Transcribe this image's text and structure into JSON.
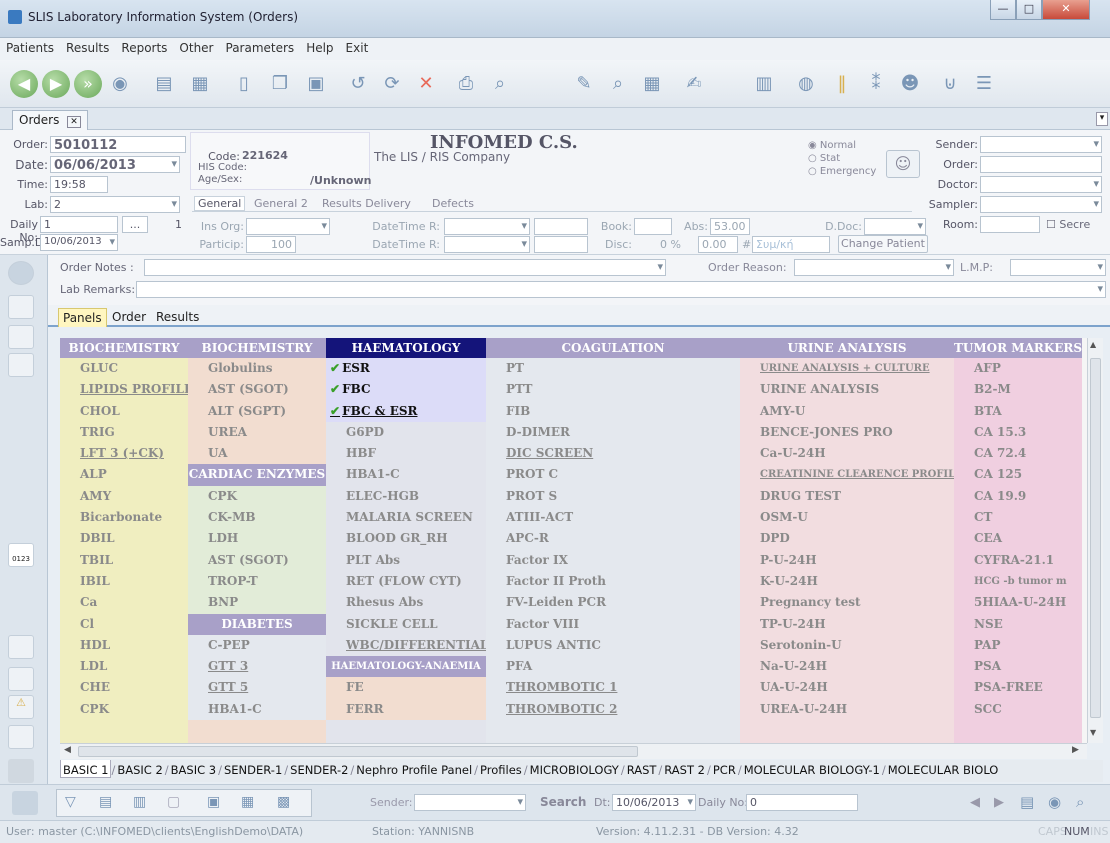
{
  "window": {
    "title": "SLIS Laboratory Information System (Orders)",
    "min": "—",
    "max": "□",
    "close": "✕"
  },
  "menu": [
    "Patients",
    "Results",
    "Reports",
    "Other",
    "Parameters",
    "Help",
    "Exit"
  ],
  "doc_tab": {
    "label": "Orders",
    "close": "✕"
  },
  "header": {
    "order_label": "Order:",
    "order_value": "5010112",
    "date_label": "Date:",
    "date_value": "06/06/2013",
    "time_label": "Time:",
    "time_value": "19:58",
    "lab_label": "Lab:",
    "lab_value": "2",
    "daily_label": "Daily No:",
    "daily_value": "1",
    "daily_count": "1",
    "daily_btn": "...",
    "samp_label": "Samp.D:",
    "samp_value": "10/06/2013",
    "code_label": "Code:",
    "code_value": "221624",
    "his_label": "HIS Code:",
    "agesex_label": "Age/Sex:",
    "agesex_value": "/Unknown",
    "company": "INFOMED C.S.",
    "company_sub": "The LIS / RIS Company",
    "priority": [
      "Normal",
      "Stat",
      "Emergency"
    ],
    "sender_label": "Sender:",
    "order2_label": "Order:",
    "doctor_label": "Doctor:",
    "sampler_label": "Sampler:",
    "room_label": "Room:",
    "secret_label": "Secre",
    "info_tabs": [
      "General",
      "General 2",
      "Results Delivery",
      "Defects"
    ],
    "ins_org_label": "Ins Org:",
    "particip_label": "Particip:",
    "particip_value": "100",
    "dtr1_label": "DateTime R:",
    "dtr2_label": "DateTime R:",
    "book_label": "Book:",
    "abs_label": "Abs:",
    "abs_value": "53.00",
    "disc_label": "Disc:",
    "disc_pct": "0 %",
    "disc_value": "0.00",
    "sym": "#",
    "sym_placeholder": "Συμ/κή",
    "ddoc_label": "D.Doc:",
    "change_patient": "Change Patient"
  },
  "notes": {
    "order_notes_label": "Order Notes :",
    "order_reason_label": "Order Reason:",
    "lmp_label": "L.M.P:",
    "lab_remarks_label": "Lab Remarks:"
  },
  "subtabs": [
    "Panels",
    "Order",
    "Results"
  ],
  "grid": [
    {
      "header": "BIOCHEMISTRY",
      "hcolor": "#a8a0c8",
      "bg": "#f0eec0",
      "items": [
        {
          "t": "GLUC"
        },
        {
          "t": "LIPIDS PROFILE",
          "ul": true
        },
        {
          "t": "CHOL"
        },
        {
          "t": "TRIG"
        },
        {
          "t": "LFT 3 (+CK)",
          "ul": true
        },
        {
          "t": "ALP"
        },
        {
          "t": "AMY"
        },
        {
          "t": "Bicarbonate"
        },
        {
          "t": "DBIL"
        },
        {
          "t": "TBIL"
        },
        {
          "t": "IBIL"
        },
        {
          "t": "Ca"
        },
        {
          "t": "Cl"
        },
        {
          "t": "HDL"
        },
        {
          "t": "LDL"
        },
        {
          "t": "CHE"
        },
        {
          "t": "CPK"
        }
      ]
    },
    {
      "header": "BIOCHEMISTRY",
      "hcolor": "#a8a0c8",
      "bg": "#f2ddd0",
      "items": [
        {
          "t": "Globulins"
        },
        {
          "t": "AST (SGOT)"
        },
        {
          "t": "ALT (SGPT)"
        },
        {
          "t": "UREA"
        },
        {
          "t": "UA"
        },
        {
          "t": "CARDIAC ENZYMES",
          "sub": "#a8a0c8"
        },
        {
          "t": "CPK",
          "bg": "#e2ecd8"
        },
        {
          "t": "CK-MB",
          "bg": "#e2ecd8"
        },
        {
          "t": "LDH",
          "bg": "#e2ecd8"
        },
        {
          "t": "AST (SGOT)",
          "bg": "#e2ecd8"
        },
        {
          "t": "TROP-T",
          "bg": "#e2ecd8"
        },
        {
          "t": "BNP",
          "bg": "#e2ecd8"
        },
        {
          "t": "DIABETES",
          "sub": "#a8a0c8"
        },
        {
          "t": "C-PEP",
          "bg": "#e4e8ee"
        },
        {
          "t": "GTT 3",
          "ul": true,
          "bg": "#e4e8ee"
        },
        {
          "t": "GTT 5",
          "ul": true,
          "bg": "#e4e8ee"
        },
        {
          "t": "HBA1-C",
          "bg": "#e4e8ee"
        }
      ]
    },
    {
      "header": "HAEMATOLOGY",
      "hcolor": "#14147a",
      "bg": "#e2e4ec",
      "items": [
        {
          "t": "ESR",
          "hl": true
        },
        {
          "t": "FBC",
          "hl": true
        },
        {
          "t": "FBC & ESR",
          "hl": true,
          "ul": true
        },
        {
          "t": "G6PD"
        },
        {
          "t": "HBF"
        },
        {
          "t": "HBA1-C"
        },
        {
          "t": "ELEC-HGB"
        },
        {
          "t": "MALARIA SCREEN"
        },
        {
          "t": "BLOOD GR_RH"
        },
        {
          "t": "PLT Abs"
        },
        {
          "t": "RET (FLOW CYT)"
        },
        {
          "t": "Rhesus Abs"
        },
        {
          "t": "SICKLE CELL"
        },
        {
          "t": "WBC/DIFFERENTIAL",
          "ul": true
        },
        {
          "t": "HAEMATOLOGY-ANAEMIA",
          "sub": "#a8a0c8",
          "sm": true
        },
        {
          "t": "FE",
          "bg": "#f2ddd0"
        },
        {
          "t": "FERR",
          "bg": "#f2ddd0"
        }
      ]
    },
    {
      "header": "COAGULATION",
      "hcolor": "#a8a0c8",
      "bg": "#e4e8ee",
      "items": [
        {
          "t": "PT"
        },
        {
          "t": "PTT"
        },
        {
          "t": "FIB"
        },
        {
          "t": "D-DIMER"
        },
        {
          "t": "DIC SCREEN",
          "ul": true
        },
        {
          "t": "PROT C"
        },
        {
          "t": "PROT S"
        },
        {
          "t": "ATIII-ACT"
        },
        {
          "t": "APC-R"
        },
        {
          "t": "Factor IX"
        },
        {
          "t": "Factor II Proth"
        },
        {
          "t": "FV-Leiden PCR"
        },
        {
          "t": "Factor VIII"
        },
        {
          "t": "LUPUS ANTIC"
        },
        {
          "t": "PFA"
        },
        {
          "t": "THROMBOTIC 1",
          "ul": true
        },
        {
          "t": "THROMBOTIC 2",
          "ul": true
        }
      ]
    },
    {
      "header": "URINE ANALYSIS",
      "hcolor": "#a8a0c8",
      "bg": "#f2dde0",
      "items": [
        {
          "t": "URINE ANALYSIS + CULTURE",
          "ul": true,
          "sm": true
        },
        {
          "t": "URINE ANALYSIS"
        },
        {
          "t": "AMY-U"
        },
        {
          "t": "BENCE-JONES PRO"
        },
        {
          "t": "Ca-U-24H"
        },
        {
          "t": "CREATININE CLEARENCE PROFILE",
          "ul": true,
          "sm": true
        },
        {
          "t": "DRUG TEST"
        },
        {
          "t": "OSM-U"
        },
        {
          "t": "DPD"
        },
        {
          "t": "P-U-24H"
        },
        {
          "t": "K-U-24H"
        },
        {
          "t": "Pregnancy test"
        },
        {
          "t": "TP-U-24H"
        },
        {
          "t": "Serotonin-U"
        },
        {
          "t": "Na-U-24H"
        },
        {
          "t": "UA-U-24H"
        },
        {
          "t": "UREA-U-24H"
        }
      ]
    },
    {
      "header": "TUMOR MARKERS",
      "hcolor": "#a8a0c8",
      "bg": "#f0cfe0",
      "items": [
        {
          "t": "AFP"
        },
        {
          "t": "B2-M"
        },
        {
          "t": "BTA"
        },
        {
          "t": "CA 15.3"
        },
        {
          "t": "CA 72.4"
        },
        {
          "t": "CA 125"
        },
        {
          "t": "CA 19.9"
        },
        {
          "t": "CT"
        },
        {
          "t": "CEA"
        },
        {
          "t": "CYFRA-21.1"
        },
        {
          "t": "HCG -b tumor m",
          "sm": true
        },
        {
          "t": "5HIAA-U-24H"
        },
        {
          "t": "NSE"
        },
        {
          "t": "PAP"
        },
        {
          "t": "PSA"
        },
        {
          "t": "PSA-FREE"
        },
        {
          "t": "SCC"
        }
      ]
    }
  ],
  "bottom_tabs": [
    "BASIC 1",
    "BASIC 2",
    "BASIC 3",
    "SENDER-1",
    "SENDER-2",
    "Nephro Profile Panel",
    "Profiles",
    "MICROBIOLOGY",
    "RAST",
    "RAST 2",
    "PCR",
    "MOLECULAR BIOLOGY-1",
    "MOLECULAR BIOLO"
  ],
  "search": {
    "sender_label": "Sender:",
    "search_label": "Search",
    "dt_label": "Dt:",
    "dt_value": "10/06/2013",
    "daily_label": "Daily No:",
    "daily_value": "0"
  },
  "status": {
    "user": "User: master  (C:\\INFOMED\\clients\\EnglishDemo\\DATA)",
    "station": "Station: YANNISNB",
    "version": "Version: 4.11.2.31  -  DB Version: 4.32",
    "caps": "CAPS",
    "num": "NUM",
    "ins": "INS"
  },
  "barcode_text": "0123"
}
